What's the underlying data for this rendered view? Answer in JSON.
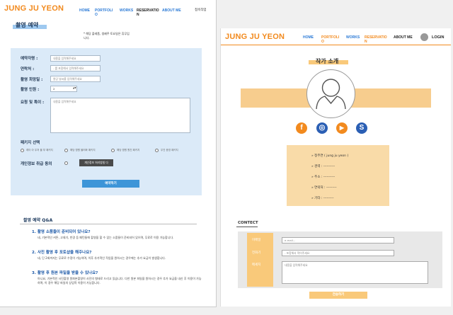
{
  "left": {
    "brand": "JUNG JU YEON",
    "nav": [
      "HOME",
      "PORTFOLI O",
      "WORKS",
      "RESERVATIO N",
      "ABOUT ME"
    ],
    "nav_right": "접속작업",
    "section_title": "촬영 예약",
    "notice": "* 해당 플레폼, 생혜주 토요일은 휴무입니다.",
    "form": {
      "name_label": "예약자명 :",
      "name_placeholder": "내용을 입력해주세요",
      "phone_label": "연락처 :",
      "phone_placeholder": "- 를 포함해서 입력해주세요",
      "date_label": "촬영 희망일 :",
      "date_placeholder": "원당 날씨를 입력해주세요",
      "people_label": "촬영 인원 :",
      "people_value": "2",
      "people_arrow": "▲▼",
      "request_label": "요청 및 특이 :",
      "request_placeholder": "내용을 입력해주세요",
      "package_label": "패키지 선택",
      "packages": [
        "레이 아 우저 블 부 패키지",
        "해당 명원 몰러화 패키지",
        "해당 명원 원친 패키지",
        "우진 종영 패키지"
      ],
      "privacy_label": "개인정보 취급 동의",
      "privacy_button": "개인정보 처리방침 다",
      "submit": "예약하기"
    },
    "qa": {
      "title": "촬영 예약 Q&A",
      "items": [
        {
          "q": "1. 촬영 소품들이 준비되어 있나요?",
          "a": "네, 기본적인 커튼, 고데기, 반경 등 패턴들에 촬영을 할 수 있는 소품들이 준비되어 있으며, 무료로 이용 가능합니다."
        },
        {
          "q": "2. 사진 촬영 후 포토샵을 해주나요?",
          "a": "네, 단 2회까지는 무료로 수정이 가능하며, 이후 추가적인 작업을 원하시는 경우에는 추가 요금이 발생합니다."
        },
        {
          "q": "3. 촬영 후 원본 파일을 받을 수 있나요?",
          "a": "아니요, 기본적인 사진촬영 원파본촬영이 사진의 형태로 드리고 있습니다. 다만 원본 파일을 원하시는 경우 추가 요금을 내신 후 이용이 가능하며, 이 경우 해당 파일의 상업적 이용이 가능합니다."
        }
      ]
    }
  },
  "right": {
    "brand": "JUNG JU YEON",
    "nav": [
      "HOME",
      "PORTFOLI O",
      "WORKS",
      "RESERVATIO N",
      "ABOUT ME"
    ],
    "login": "LOGIN",
    "section_title": "작가 소개",
    "social": [
      {
        "icon": "facebook-icon",
        "glyph": "f",
        "color": "#f28a1e"
      },
      {
        "icon": "instagram-icon",
        "glyph": "◎",
        "color": "#2b5fb4"
      },
      {
        "icon": "youtube-icon",
        "glyph": "▶",
        "color": "#f28a1e"
      },
      {
        "icon": "skype-icon",
        "glyph": "S",
        "color": "#2b5fb4"
      }
    ],
    "info": [
      "» 정주연 ( jung ju yeon )",
      "» 경력 : ----------",
      "» 주소 : ----------",
      "» 연락처 : ---------",
      "» 기타 : ---------"
    ],
    "contact": {
      "title": "CONTECT",
      "email_label": "이메일",
      "email_placeholder": "e-mail...",
      "phone_label": "전화기",
      "phone_placeholder": "- 포함해서 적어주세요",
      "message_label": "메세지",
      "message_placeholder": "내용을 입력해주세요",
      "submit": "전송하기"
    }
  },
  "colors": {
    "brand_orange": "#f28a1e",
    "nav_blue": "#2b7ad6",
    "light_blue_panel": "#dbeaf8",
    "button_blue": "#3d95d8",
    "peach": "#f7cd8e",
    "tan": "#f9dba8"
  }
}
